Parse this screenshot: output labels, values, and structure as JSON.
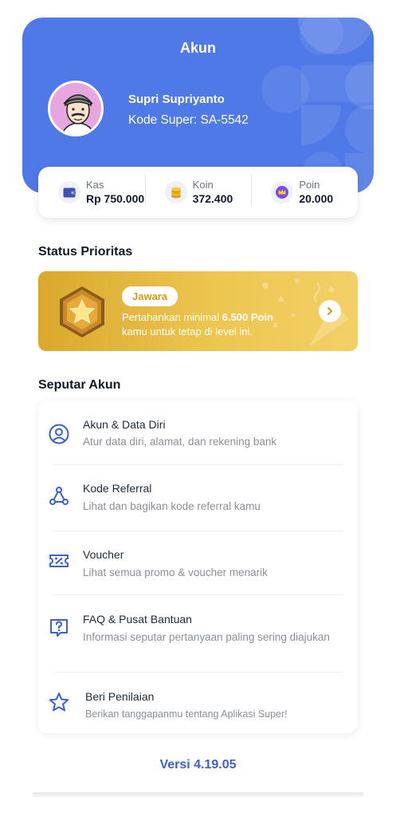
{
  "header": {
    "title": "Akun"
  },
  "profile": {
    "name": "Supri Supriyanto",
    "code": "Kode Super: SA-5542"
  },
  "balances": [
    {
      "label": "Kas",
      "value": "Rp 750.000",
      "icon": "wallet-icon",
      "color": "#4f67d8"
    },
    {
      "label": "Koin",
      "value": "372.400",
      "icon": "coin-icon",
      "color": "#f1b624"
    },
    {
      "label": "Poin",
      "value": "20.000",
      "icon": "crown-icon",
      "color": "#7b4fd8"
    }
  ],
  "priority": {
    "section_title": "Status Prioritas",
    "level": "Jawara",
    "desc_prefix": "Pertahankan minimal ",
    "desc_points": "6.500 Poin",
    "desc_suffix": "kamu untuk tetap di level ini."
  },
  "account": {
    "section_title": "Seputar Akun",
    "items": [
      {
        "title": "Akun & Data Diri",
        "subtitle": "Atur data diri, alamat, dan rekening bank",
        "icon": "user-circle-icon"
      },
      {
        "title": "Kode Referral",
        "subtitle": "Lihat dan bagikan kode referral kamu",
        "icon": "share-network-icon"
      },
      {
        "title": "Voucher",
        "subtitle": "Lihat semua promo & voucher menarik",
        "icon": "voucher-icon"
      },
      {
        "title": "FAQ & Pusat Bantuan",
        "subtitle": "Informasi seputar pertanyaan paling sering diajukan",
        "icon": "question-chat-icon"
      },
      {
        "title": "Beri Penilaian",
        "subtitle": "Berikan tanggapanmu tentang Aplikasi Super!",
        "icon": "star-icon"
      }
    ]
  },
  "version": "Versi 4.19.05",
  "colors": {
    "primary": "#4f79e6",
    "accent": "#3b5fd9",
    "gold": "#e8bd45"
  }
}
